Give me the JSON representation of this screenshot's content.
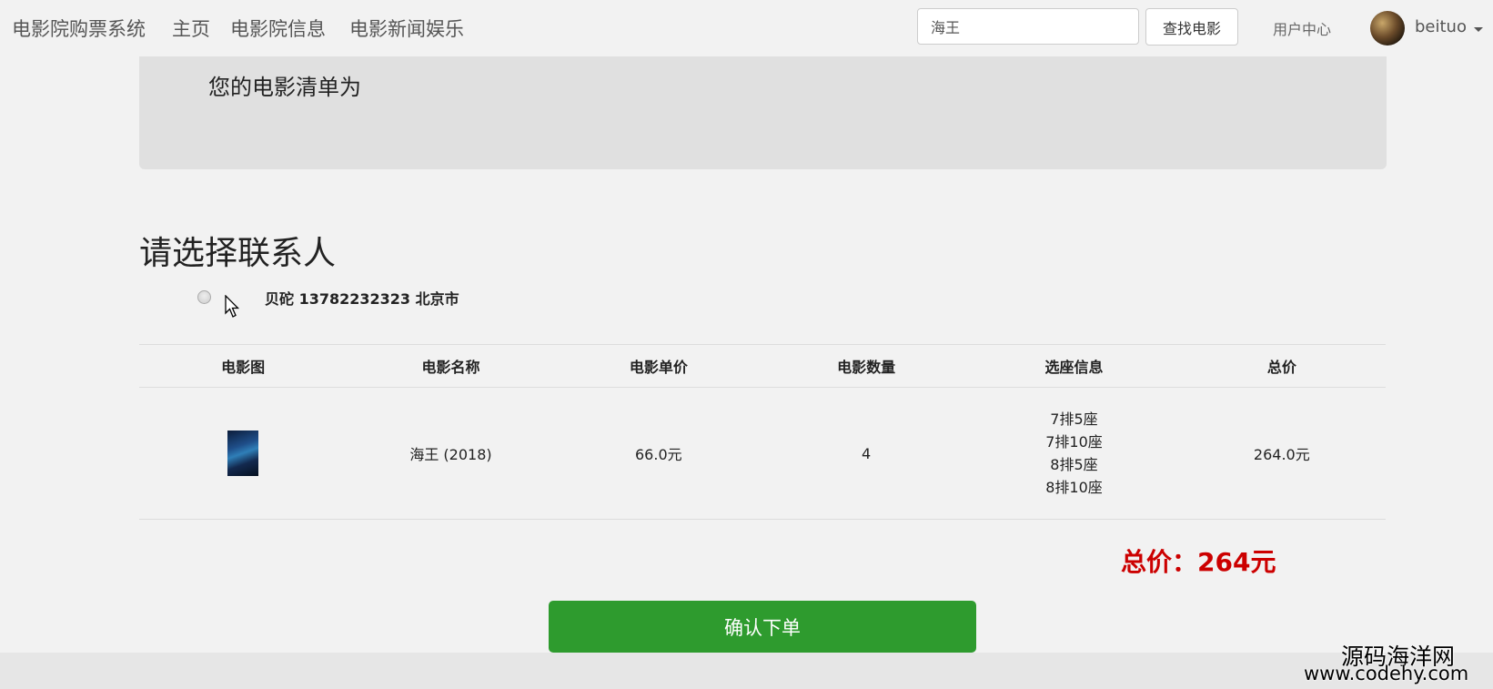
{
  "navbar": {
    "brand": "电影院购票系统",
    "links": [
      "主页",
      "电影院信息",
      "电影新闻娱乐"
    ],
    "search": {
      "value": "海王"
    },
    "search_button": "查找电影",
    "user_center": "用户中心",
    "username": "beituo"
  },
  "jumbotron": {
    "text": "您的电影清单为"
  },
  "contact": {
    "title": "请选择联系人",
    "item": "贝砣 13782232323 北京市"
  },
  "table": {
    "headers": [
      "电影图",
      "电影名称",
      "电影单价",
      "电影数量",
      "选座信息",
      "总价"
    ],
    "rows": [
      {
        "name": "海王 (2018)",
        "unit_price": "66.0元",
        "quantity": "4",
        "seats": [
          "7排5座",
          "7排10座",
          "8排5座",
          "8排10座"
        ],
        "total": "264.0元"
      }
    ]
  },
  "total_price": "总价：264元",
  "confirm_button": "确认下单",
  "watermark": {
    "line1": "源码海洋网",
    "line2": "www.codehy.com"
  },
  "colors": {
    "accent_green": "#2e9b2e",
    "total_red": "#cc0000"
  }
}
